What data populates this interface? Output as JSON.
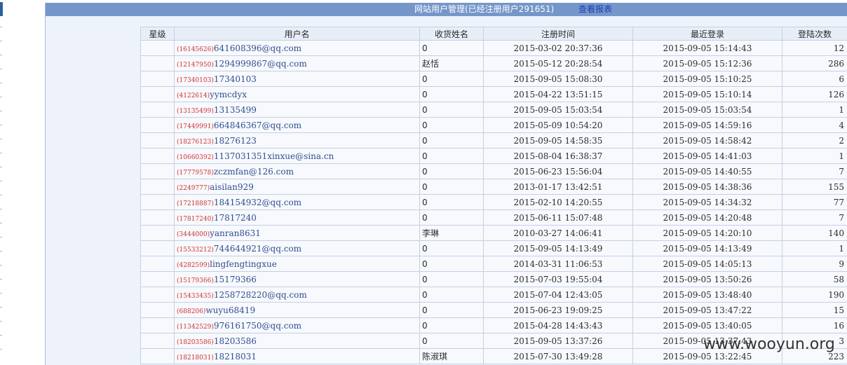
{
  "header": {
    "title": "网站用户管理(已经注册用户291651)",
    "report_link": "查看报表"
  },
  "table": {
    "columns": [
      "星级",
      "用户名",
      "收货姓名",
      "注册时间",
      "最近登录",
      "登陆次数"
    ],
    "rows": [
      {
        "star": "",
        "uid": "(16145626)",
        "username": "641608396@qq.com",
        "recipient": "0",
        "registered": "2015-03-02 20:37:36",
        "last_login": "2015-09-05 15:14:43",
        "logins": "12"
      },
      {
        "star": "",
        "uid": "(12147950)",
        "username": "1294999867@qq.com",
        "recipient": "赵恬",
        "registered": "2015-05-12 20:28:54",
        "last_login": "2015-09-05 15:12:36",
        "logins": "286"
      },
      {
        "star": "",
        "uid": "(17340103)",
        "username": "17340103",
        "recipient": "0",
        "registered": "2015-09-05 15:08:30",
        "last_login": "2015-09-05 15:10:25",
        "logins": "6"
      },
      {
        "star": "",
        "uid": "(4122614)",
        "username": "yymcdyx",
        "recipient": "0",
        "registered": "2015-04-22 13:51:15",
        "last_login": "2015-09-05 15:10:14",
        "logins": "126"
      },
      {
        "star": "",
        "uid": "(13135499)",
        "username": "13135499",
        "recipient": "0",
        "registered": "2015-09-05 15:03:54",
        "last_login": "2015-09-05 15:03:54",
        "logins": "1"
      },
      {
        "star": "",
        "uid": "(17449991)",
        "username": "664846367@qq.com",
        "recipient": "0",
        "registered": "2015-05-09 10:54:20",
        "last_login": "2015-09-05 14:59:16",
        "logins": "4"
      },
      {
        "star": "",
        "uid": "(18276123)",
        "username": "18276123",
        "recipient": "0",
        "registered": "2015-09-05 14:58:35",
        "last_login": "2015-09-05 14:58:42",
        "logins": "2"
      },
      {
        "star": "",
        "uid": "(10660392)",
        "username": "1137031351xinxue@sina.cn",
        "recipient": "0",
        "registered": "2015-08-04 16:38:37",
        "last_login": "2015-09-05 14:41:03",
        "logins": "1"
      },
      {
        "star": "",
        "uid": "(17779578)",
        "username": "zczmfan@126.com",
        "recipient": "0",
        "registered": "2015-06-23 15:56:04",
        "last_login": "2015-09-05 14:40:55",
        "logins": "7"
      },
      {
        "star": "",
        "uid": "(2249777)",
        "username": "aisilan929",
        "recipient": "0",
        "registered": "2013-01-17 13:42:51",
        "last_login": "2015-09-05 14:38:36",
        "logins": "155"
      },
      {
        "star": "",
        "uid": "(17218887)",
        "username": "184154932@qq.com",
        "recipient": "0",
        "registered": "2015-02-10 14:20:55",
        "last_login": "2015-09-05 14:34:32",
        "logins": "77"
      },
      {
        "star": "",
        "uid": "(17817240)",
        "username": "17817240",
        "recipient": "0",
        "registered": "2015-06-11 15:07:48",
        "last_login": "2015-09-05 14:20:48",
        "logins": "7"
      },
      {
        "star": "",
        "uid": "(3444000)",
        "username": "yanran8631",
        "recipient": "李琳",
        "registered": "2010-03-27 14:06:41",
        "last_login": "2015-09-05 14:20:10",
        "logins": "140"
      },
      {
        "star": "",
        "uid": "(15533212)",
        "username": "744644921@qq.com",
        "recipient": "0",
        "registered": "2015-09-05 14:13:49",
        "last_login": "2015-09-05 14:13:49",
        "logins": "1"
      },
      {
        "star": "",
        "uid": "(4282599)",
        "username": "lingfengtingxue",
        "recipient": "0",
        "registered": "2014-03-31 11:06:53",
        "last_login": "2015-09-05 14:05:13",
        "logins": "9"
      },
      {
        "star": "",
        "uid": "(15179366)",
        "username": "15179366",
        "recipient": "0",
        "registered": "2015-07-03 19:55:04",
        "last_login": "2015-09-05 13:50:26",
        "logins": "58"
      },
      {
        "star": "",
        "uid": "(15433435)",
        "username": "1258728220@qq.com",
        "recipient": "0",
        "registered": "2015-07-04 12:43:05",
        "last_login": "2015-09-05 13:48:40",
        "logins": "190"
      },
      {
        "star": "",
        "uid": "(688206)",
        "username": "wuyu68419",
        "recipient": "0",
        "registered": "2015-06-23 19:09:25",
        "last_login": "2015-09-05 13:47:22",
        "logins": "15"
      },
      {
        "star": "",
        "uid": "(11342529)",
        "username": "976161750@qq.com",
        "recipient": "0",
        "registered": "2015-04-28 14:43:43",
        "last_login": "2015-09-05 13:40:05",
        "logins": "16"
      },
      {
        "star": "",
        "uid": "(18203586)",
        "username": "18203586",
        "recipient": "0",
        "registered": "2015-09-05 13:37:26",
        "last_login": "2015-09-05 13:37:43",
        "logins": "3"
      },
      {
        "star": "",
        "uid": "(18218031)",
        "username": "18218031",
        "recipient": "陈淑琪",
        "registered": "2015-07-30 13:49:28",
        "last_login": "2015-09-05 13:22:45",
        "logins": "223"
      }
    ]
  },
  "watermark": "www.wooyun.org",
  "colors": {
    "header_bg": "#7596c9",
    "panel_bg": "#eef3fb",
    "link": "#1b3db5",
    "uid_red": "#d03030",
    "username_blue": "#2f4f8f"
  }
}
